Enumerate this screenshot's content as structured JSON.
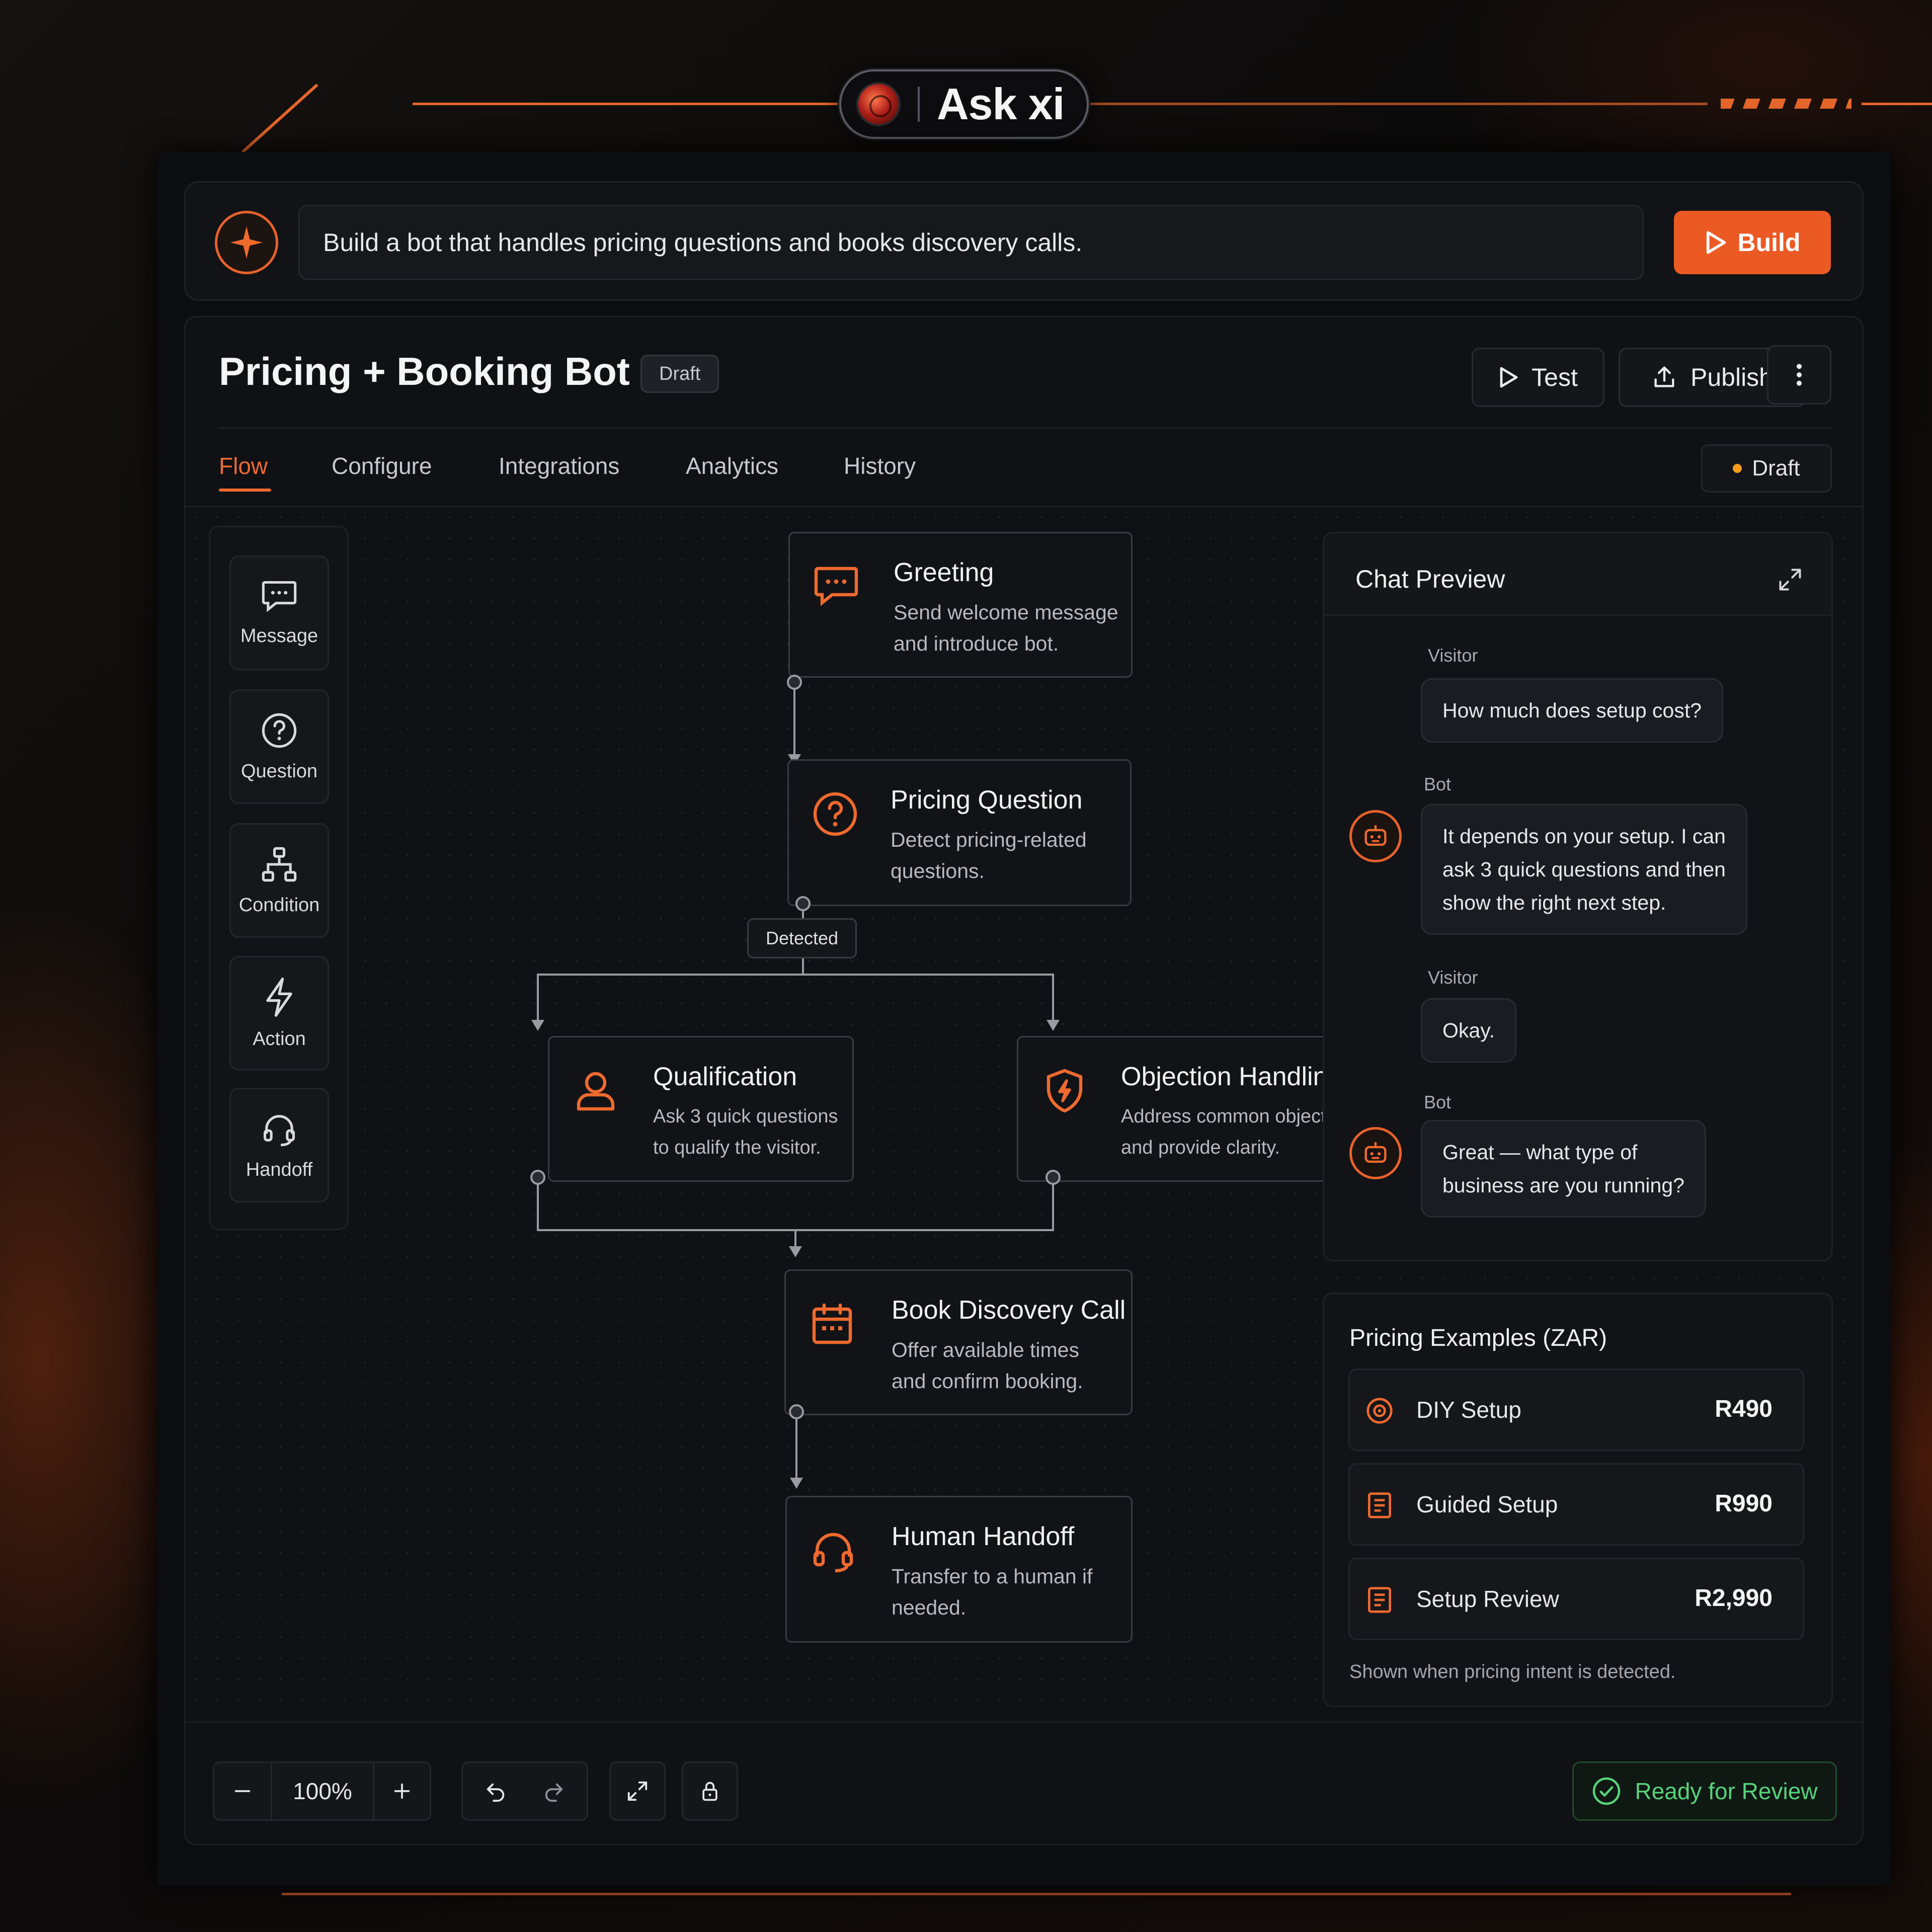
{
  "brand": {
    "name": "Ask xi"
  },
  "prompt": {
    "text": "Build a bot that handles pricing questions and books discovery calls.",
    "build_label": "Build"
  },
  "bot": {
    "title": "Pricing + Booking Bot",
    "draft_chip": "Draft",
    "test_label": "Test",
    "publish_label": "Publish"
  },
  "tabs": [
    {
      "label": "Flow",
      "active": true
    },
    {
      "label": "Configure",
      "active": false
    },
    {
      "label": "Integrations",
      "active": false
    },
    {
      "label": "Analytics",
      "active": false
    },
    {
      "label": "History",
      "active": false
    }
  ],
  "status": {
    "label": "Draft",
    "color": "#f59c1a"
  },
  "palette": [
    {
      "label": "Message",
      "icon": "message-icon"
    },
    {
      "label": "Question",
      "icon": "question-icon"
    },
    {
      "label": "Condition",
      "icon": "condition-icon"
    },
    {
      "label": "Action",
      "icon": "lightning-icon"
    },
    {
      "label": "Handoff",
      "icon": "headset-icon"
    }
  ],
  "flow": {
    "nodes": [
      {
        "title": "Greeting",
        "desc_1": "Send welcome message",
        "desc_2": "and introduce bot.",
        "icon": "chat-bubble-icon"
      },
      {
        "title": "Pricing Question",
        "desc_1": "Detect pricing-related",
        "desc_2": "questions.",
        "icon": "question-icon"
      },
      {
        "title": "Qualification",
        "desc_1": "Ask 3 quick questions",
        "desc_2": "to qualify the visitor.",
        "icon": "user-icon"
      },
      {
        "title": "Objection Handling",
        "desc_1": "Address common objections",
        "desc_2": "and provide clarity.",
        "icon": "shield-bolt-icon"
      },
      {
        "title": "Book Discovery Call",
        "desc_1": "Offer available times",
        "desc_2": "and confirm booking.",
        "icon": "calendar-icon"
      },
      {
        "title": "Human Handoff",
        "desc_1": "Transfer to a human if",
        "desc_2": "needed.",
        "icon": "headset-icon"
      }
    ],
    "branch_label": "Detected"
  },
  "chat": {
    "title": "Chat Preview",
    "messages": [
      {
        "sender": "Visitor",
        "lines": [
          "How much does setup cost?"
        ]
      },
      {
        "sender": "Bot",
        "lines": [
          "It depends on your setup. I can",
          "ask 3 quick questions and then",
          "show the right next step."
        ]
      },
      {
        "sender": "Visitor",
        "lines": [
          "Okay."
        ]
      },
      {
        "sender": "Bot",
        "lines": [
          "Great — what type of",
          "business are you running?"
        ]
      }
    ]
  },
  "pricing": {
    "title": "Pricing Examples (ZAR)",
    "items": [
      {
        "name": "DIY Setup",
        "price": "R490",
        "icon": "target-icon"
      },
      {
        "name": "Guided Setup",
        "price": "R990",
        "icon": "receipt-icon"
      },
      {
        "name": "Setup Review",
        "price": "R2,990",
        "icon": "receipt-icon"
      }
    ],
    "note": "Shown when pricing intent is detected."
  },
  "toolbar": {
    "zoom": "100%",
    "ready_label": "Ready for Review"
  },
  "colors": {
    "accent": "#ec5a24",
    "success": "#57d37b",
    "background": "#0c0d10"
  }
}
